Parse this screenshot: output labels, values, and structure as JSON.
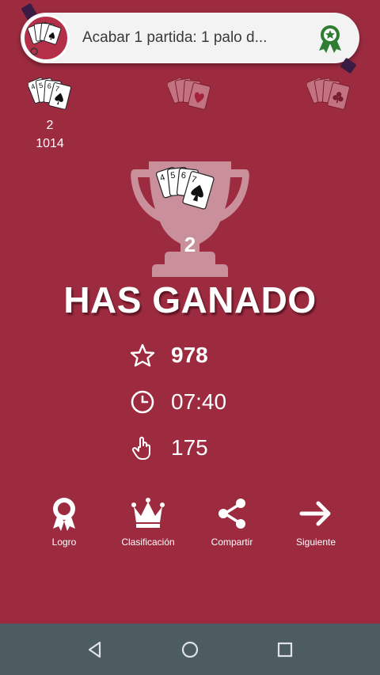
{
  "toast": {
    "text": "Acabar 1 partida: 1 palo d...",
    "award_icon": "award-ribbon-icon"
  },
  "piles": {
    "spades_count": "2",
    "score": "1014"
  },
  "trophy": {
    "level": "2"
  },
  "result": {
    "title": "HAS GANADO"
  },
  "stats": {
    "points": "978",
    "time": "07:40",
    "moves": "175"
  },
  "actions": [
    {
      "label": "Logro",
      "icon": "award-icon"
    },
    {
      "label": "Clasificación",
      "icon": "crown-icon"
    },
    {
      "label": "Compartir",
      "icon": "share-icon"
    },
    {
      "label": "Siguiente",
      "icon": "arrow-right-icon"
    }
  ],
  "colors": {
    "background": "#9c2b40",
    "toast_bg": "#f3f3f3",
    "award_green": "#2e7d32",
    "navbar": "#4d5c61"
  }
}
